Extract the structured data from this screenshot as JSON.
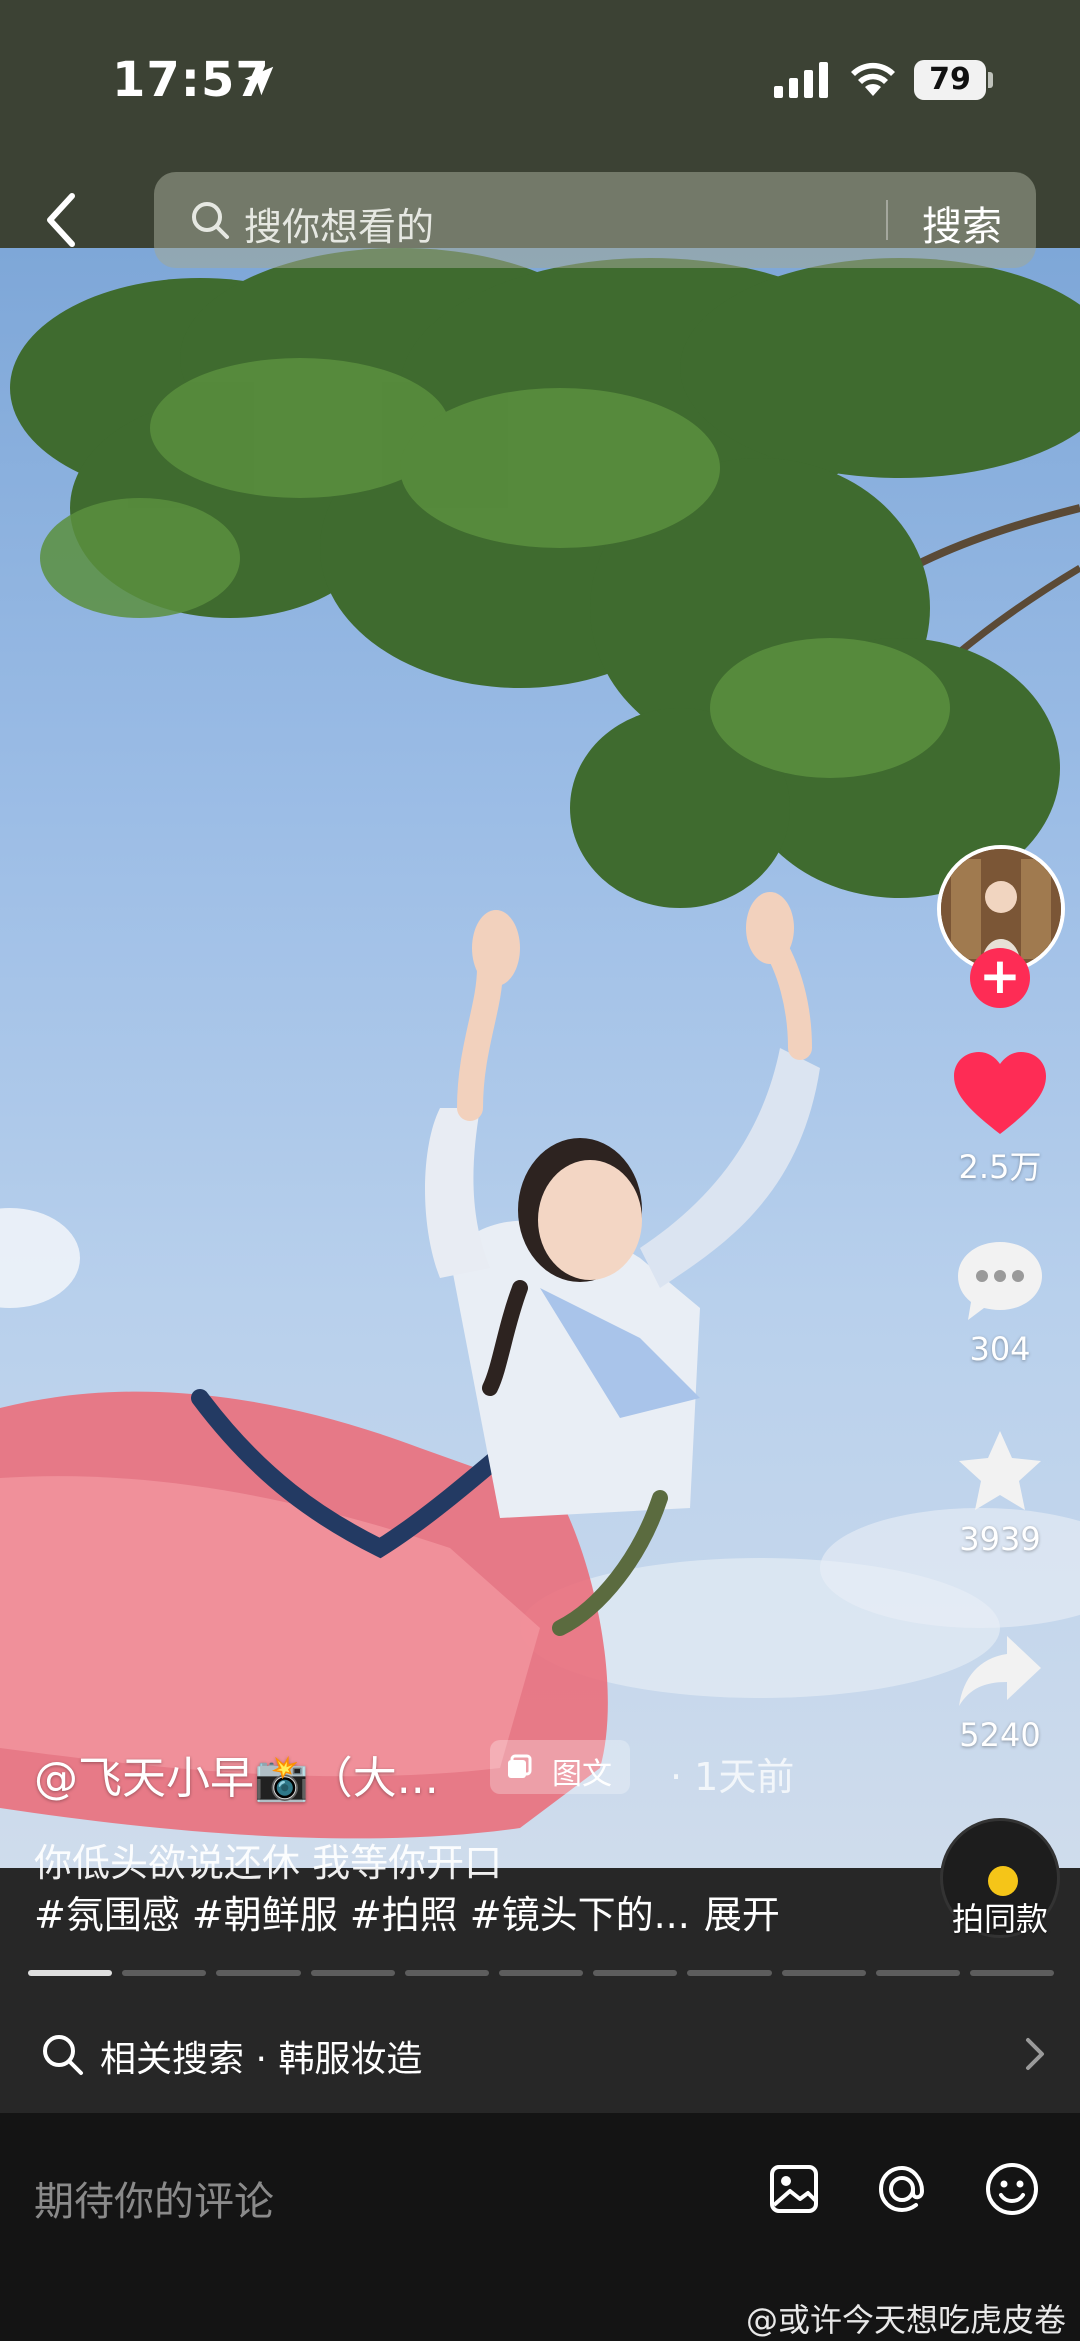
{
  "status_bar": {
    "time": "17:57",
    "battery": "79"
  },
  "search": {
    "placeholder": "搜你想看的",
    "button": "搜索"
  },
  "author": {
    "name": "@飞天小早📸（大..."
  },
  "post": {
    "type_tag": "图文",
    "time_ago": "· 1天前",
    "description": "你低头欲说还休 我等你开口",
    "tags": "#氛围感 #朝鲜服 #拍照 #镜头下的...",
    "expand_label": "展开"
  },
  "actions": {
    "likes": "2.5万",
    "comments": "304",
    "favorites": "3939",
    "shares": "5240",
    "shoot_same": "拍同款"
  },
  "progress": {
    "total": 11,
    "current": 1
  },
  "related_search": {
    "label": "相关搜索 · 韩服妆造"
  },
  "comment_input": {
    "placeholder": "期待你的评论"
  },
  "watermark": "@或许今天想吃虎皮卷",
  "colors": {
    "accent": "#fe2c55",
    "like": "#fe2c55",
    "top_bar": "#3c4234"
  }
}
